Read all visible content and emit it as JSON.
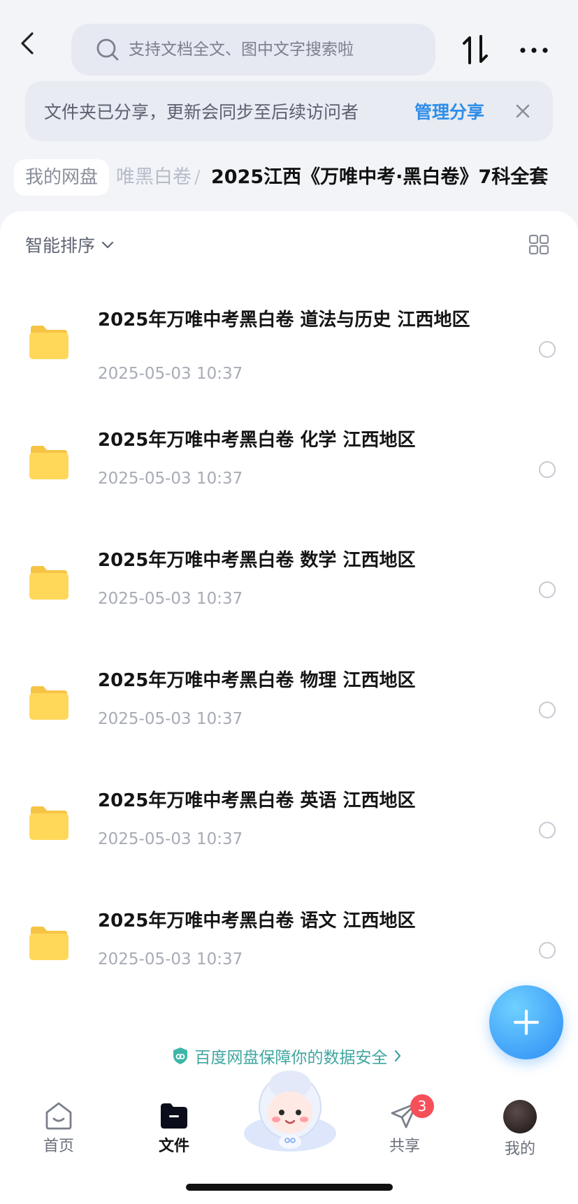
{
  "search": {
    "placeholder": "支持文档全文、图中文字搜索啦"
  },
  "share_banner": {
    "text": "文件夹已分享，更新会同步至后续访问者",
    "manage_label": "管理分享"
  },
  "breadcrumb": {
    "root": "我的网盘",
    "faded": "唯黑白卷",
    "separator": "/",
    "current": "2025江西《万唯中考·黑白卷》7科全套"
  },
  "sort": {
    "label": "智能排序"
  },
  "files": [
    {
      "name": "2025年万唯中考黑白卷 道法与历史 江西地区",
      "date": "2025-05-03 10:37"
    },
    {
      "name": "2025年万唯中考黑白卷 化学 江西地区",
      "date": "2025-05-03 10:37"
    },
    {
      "name": "2025年万唯中考黑白卷 数学 江西地区",
      "date": "2025-05-03 10:37"
    },
    {
      "name": "2025年万唯中考黑白卷 物理 江西地区",
      "date": "2025-05-03 10:37"
    },
    {
      "name": "2025年万唯中考黑白卷 英语 江西地区",
      "date": "2025-05-03 10:37"
    },
    {
      "name": "2025年万唯中考黑白卷 语文 江西地区",
      "date": "2025-05-03 10:37"
    }
  ],
  "security_note": "百度网盘保障你的数据安全",
  "tabs": [
    {
      "label": "首页",
      "icon": "home-icon"
    },
    {
      "label": "文件",
      "icon": "folder-tab-icon",
      "active": true
    },
    {
      "label": "共享",
      "icon": "send-icon",
      "badge": "3"
    },
    {
      "label": "我的",
      "icon": "avatar"
    }
  ],
  "colors": {
    "accent": "#2f8ee8",
    "folder": "#ffd85a",
    "badge": "#f5505a",
    "security": "#3fa6a0"
  }
}
